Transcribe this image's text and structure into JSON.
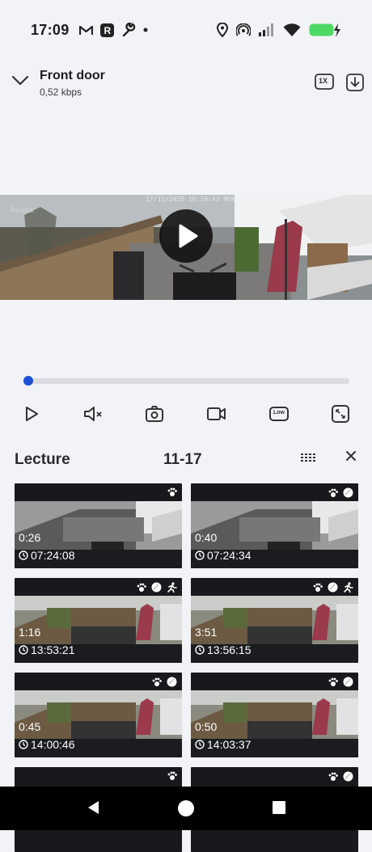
{
  "status_bar": {
    "time": "17:09",
    "left_icons": [
      "gmail-icon",
      "r-app-icon",
      "wrench-icon",
      "dot-icon"
    ],
    "right_icons": [
      "location-icon",
      "hotspot-icon",
      "signal-icon",
      "wifi-icon",
      "battery-charging-icon"
    ],
    "battery_color": "#4cd964"
  },
  "header": {
    "title": "Front door",
    "bitrate": "0,52 kbps",
    "speed_label": "1X"
  },
  "video": {
    "timestamp": "17/11/2025 16:59:43 MON",
    "watermark": "Reolink"
  },
  "progress": {
    "fraction": 0.0,
    "accent": "#1d4fd7"
  },
  "controls": [
    "play-icon",
    "mute-icon",
    "snapshot-icon",
    "record-icon",
    "quality-low-icon",
    "fullscreen-icon"
  ],
  "quality_label": "Low",
  "list": {
    "label": "Lecture",
    "date": "11-17"
  },
  "clips": [
    {
      "duration": "0:26",
      "time": "07:24:08",
      "badges": [
        "pet"
      ],
      "style": "mono"
    },
    {
      "duration": "0:40",
      "time": "07:24:34",
      "badges": [
        "pet",
        "vehicle"
      ],
      "style": "mono"
    },
    {
      "duration": "1:16",
      "time": "13:53:21",
      "badges": [
        "pet",
        "vehicle",
        "person"
      ],
      "style": "color"
    },
    {
      "duration": "3:51",
      "time": "13:56:15",
      "badges": [
        "pet",
        "vehicle",
        "person"
      ],
      "style": "color"
    },
    {
      "duration": "0:45",
      "time": "14:00:46",
      "badges": [
        "pet",
        "vehicle"
      ],
      "style": "color"
    },
    {
      "duration": "0:50",
      "time": "14:03:37",
      "badges": [
        "pet",
        "vehicle"
      ],
      "style": "color"
    },
    {
      "duration": "",
      "time": "",
      "badges": [
        "pet"
      ],
      "style": "partial"
    },
    {
      "duration": "",
      "time": "",
      "badges": [
        "pet",
        "vehicle"
      ],
      "style": "partial"
    }
  ]
}
